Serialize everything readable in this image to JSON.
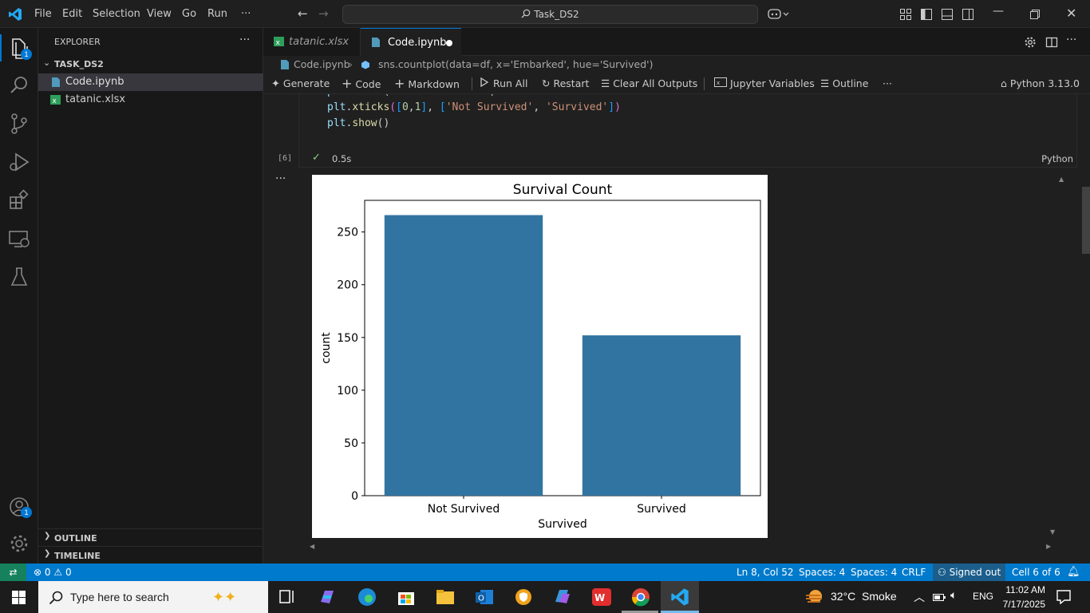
{
  "titlebar": {
    "menus": [
      "File",
      "Edit",
      "Selection",
      "View",
      "Go",
      "Run",
      "···"
    ],
    "search": "Task_DS2"
  },
  "activitybar": {
    "explorer_badge": "1",
    "accounts_badge": "1"
  },
  "sidebar": {
    "title": "EXPLORER",
    "more": "···",
    "folder": "TASK_DS2",
    "files": [
      "Code.ipynb",
      "tatanic.xlsx"
    ],
    "outline": "OUTLINE",
    "timeline": "TIMELINE"
  },
  "tabs": [
    {
      "label": "tatanic.xlsx"
    },
    {
      "label": "Code.ipynb"
    }
  ],
  "breadcrumb": {
    "file": "Code.ipynb",
    "symbol": "sns.countplot(data=df, x='Embarked', hue='Survived')"
  },
  "toolbar": {
    "generate": "Generate",
    "code": "Code",
    "markdown": "Markdown",
    "run_all": "Run All",
    "restart": "Restart",
    "clear": "Clear All Outputs",
    "variables": "Jupyter Variables",
    "outline": "Outline",
    "more": "···",
    "kernel": "Python 3.13.0"
  },
  "cell": {
    "lines": [
      "plt.title('Survival Count')",
      "plt.xticks([0,1], ['Not Survived', 'Survived'])",
      "plt.show()"
    ],
    "exec_count": "[6]",
    "check": "✓",
    "time": "0.5s",
    "language": "Python",
    "output_more": "···"
  },
  "chart_data": {
    "type": "bar",
    "title": "Survival Count",
    "xlabel": "Survived",
    "ylabel": "count",
    "categories": [
      "Not Survived",
      "Survived"
    ],
    "values": [
      266,
      152
    ],
    "ylim": [
      0,
      280
    ],
    "yticks": [
      0,
      50,
      100,
      150,
      200,
      250
    ],
    "bar_color": "#3274a1",
    "grid": false
  },
  "statusbar": {
    "errors": "0",
    "warnings": "0",
    "position": "Ln 8, Col 52",
    "spaces1": "Spaces: 4",
    "spaces2": "Spaces: 4",
    "eol": "CRLF",
    "account": "Signed out",
    "cell": "Cell 6 of 6"
  },
  "taskbar": {
    "search_placeholder": "Type here to search",
    "weather": "32°C  Smoke",
    "lang": "ENG",
    "time": "11:02 AM",
    "date": "7/17/2025"
  },
  "colors": {
    "accent": "#007acc",
    "bar": "#3274a1",
    "code_func": "#dcdcaa",
    "code_string": "#ce9178",
    "code_number": "#b5cea8"
  }
}
